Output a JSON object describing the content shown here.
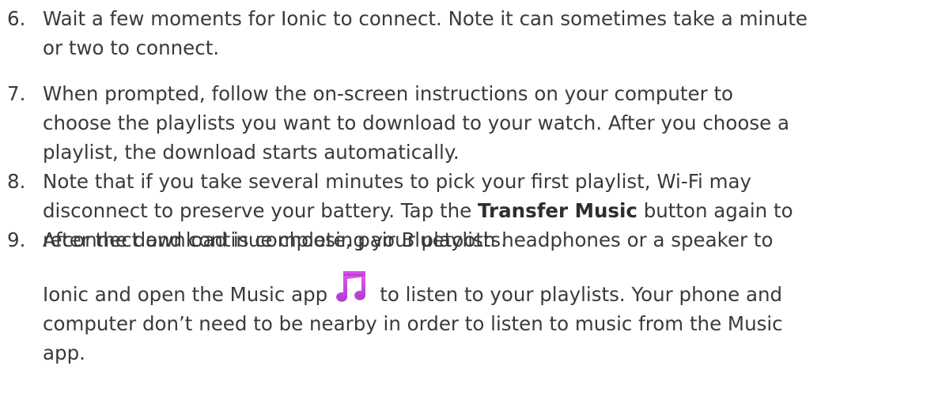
{
  "steps": [
    {
      "number": "6.",
      "lines": [
        "Wait a few moments for Ionic to connect. Note it can sometimes take a minute",
        "or two to connect."
      ]
    },
    {
      "number": "7.",
      "lines": [
        "When prompted, follow the on-screen instructions on your computer to",
        "choose the playlists you want to download to your watch. After you choose a",
        "playlist, the download starts automatically."
      ]
    },
    {
      "number": "8.",
      "line1": "Note that if you take several minutes to pick your first playlist, Wi-Fi may",
      "line2_before": "disconnect to preserve your battery. Tap the ",
      "line2_bold": "Transfer Music",
      "line2_after": " button again to",
      "line3": "reconnect and continue choosing your playlists."
    },
    {
      "number": "9.",
      "line1": "After the download is complete, pair Bluetooth headphones or a speaker to",
      "line2_before": "Ionic and open the Music app",
      "line2_after": "to listen to your playlists. Your phone and",
      "line3": "computer don’t need to be nearby in order to listen to music from the Music",
      "line4": "app.",
      "icon": "music-note-icon",
      "icon_color_top": "#e05be8",
      "icon_color_bottom": "#b23ad6"
    }
  ]
}
